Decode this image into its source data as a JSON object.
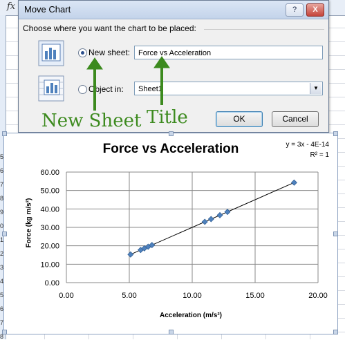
{
  "spreadsheet": {
    "formula_prefix": "fx",
    "row_numbers": [
      "5",
      "6",
      "7",
      "8",
      "9",
      "0",
      "1",
      "2",
      "3",
      "4",
      "5",
      "6",
      "7",
      "8"
    ]
  },
  "dialog": {
    "title": "Move Chart",
    "help_button": "?",
    "close_button": "X",
    "prompt": "Choose where you want the chart to be placed:",
    "new_sheet": {
      "label": "New sheet:",
      "selected": true,
      "value": "Force vs Acceleration"
    },
    "object_in": {
      "label": "Object in:",
      "selected": false,
      "value": "Sheet1"
    },
    "ok_label": "OK",
    "cancel_label": "Cancel"
  },
  "annotations": {
    "new_sheet": "New Sheet",
    "title": "Title",
    "arrow_color": "#3c8a1e"
  },
  "chart_data": {
    "type": "scatter",
    "title": "Force vs Acceleration",
    "xlabel": "Acceleration (m/s²)",
    "ylabel": "Force (kg m/s²)",
    "xlim": [
      0,
      20
    ],
    "ylim": [
      0,
      60
    ],
    "x_ticks": [
      "0.00",
      "5.00",
      "10.00",
      "15.00",
      "20.00"
    ],
    "y_ticks": [
      "0.00",
      "10.00",
      "20.00",
      "30.00",
      "40.00",
      "50.00",
      "60.00"
    ],
    "grid": true,
    "trendline": {
      "equation": "y = 3x - 4E-14",
      "r_squared": "R² = 1",
      "slope": 3,
      "intercept": 0
    },
    "series": [
      {
        "marker_color": "#4f81bd",
        "points": [
          {
            "x": 5.1,
            "y": 15.3
          },
          {
            "x": 5.9,
            "y": 17.7
          },
          {
            "x": 6.2,
            "y": 18.6
          },
          {
            "x": 6.5,
            "y": 19.5
          },
          {
            "x": 6.8,
            "y": 20.4
          },
          {
            "x": 11.0,
            "y": 33.0
          },
          {
            "x": 11.5,
            "y": 34.5
          },
          {
            "x": 12.2,
            "y": 36.6
          },
          {
            "x": 12.8,
            "y": 38.4
          },
          {
            "x": 18.1,
            "y": 54.3
          }
        ]
      }
    ]
  }
}
